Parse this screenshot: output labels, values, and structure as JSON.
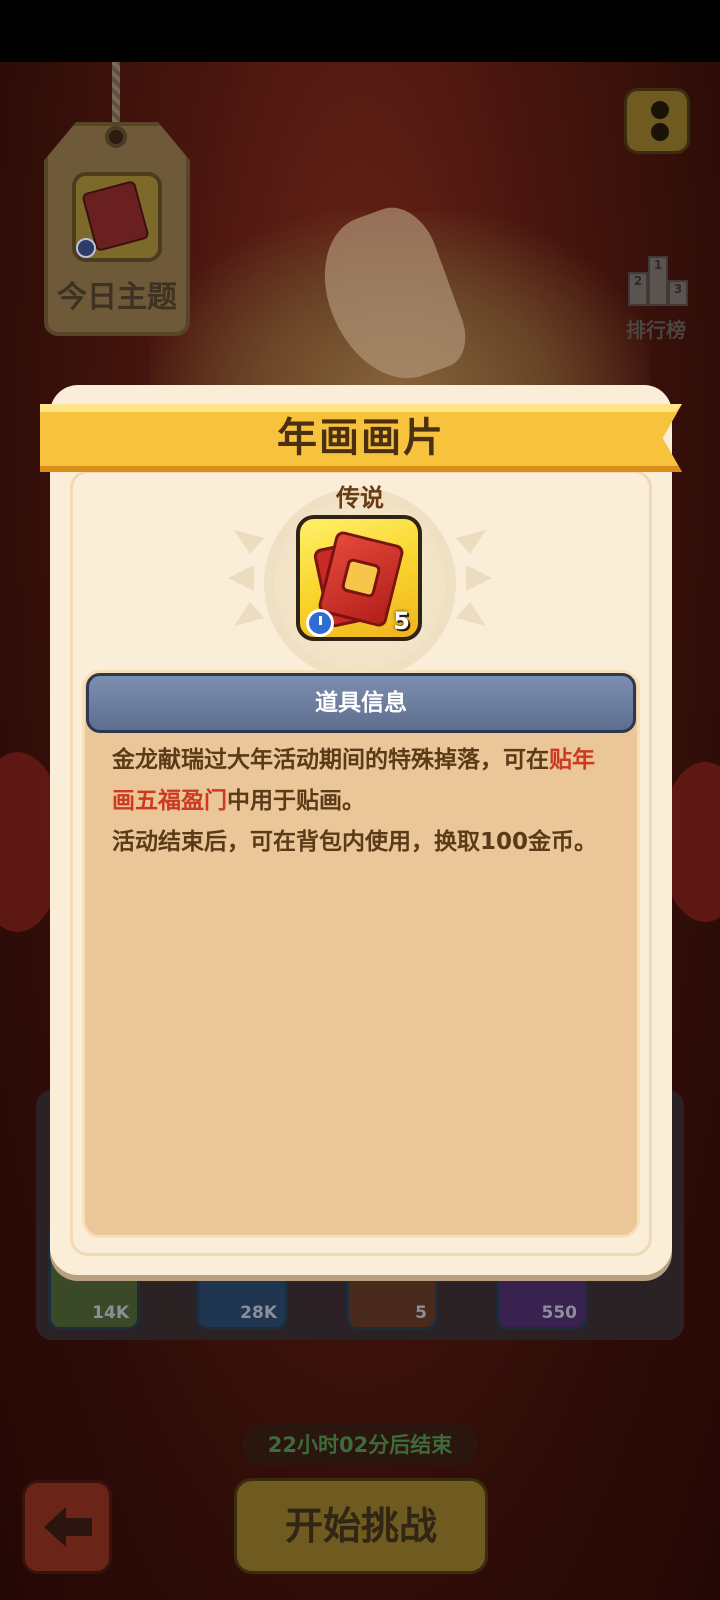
{
  "theme": {
    "label": "今日主题"
  },
  "rank": {
    "label": "排行榜",
    "podium": [
      "2",
      "1",
      "3"
    ]
  },
  "bottom_items": [
    {
      "count": "14K",
      "color": "#6a7a2e"
    },
    {
      "count": "28K",
      "color": "#2d4d7a"
    },
    {
      "count": "5",
      "color": "#6b2a22"
    },
    {
      "count": "550",
      "color": "#4a2b66"
    }
  ],
  "timer": {
    "text": "22小时02分后结束"
  },
  "start_button": {
    "label": "开始挑战"
  },
  "modal": {
    "title": "年画画片",
    "rarity": "传说",
    "item_count": "5",
    "info_header": "道具信息",
    "description": {
      "p1_part1": "金龙献瑞过大年活动期间的特殊掉落，可在",
      "p1_highlight": "贴年画五福盈门",
      "p1_part2": "中用于贴画。",
      "p2": "活动结束后，可在背包内使用，换取100金币。"
    }
  },
  "colors": {
    "ribbon": "#f7c23c",
    "highlight": "#cc3a22",
    "info_header": "#6e7e9e"
  }
}
